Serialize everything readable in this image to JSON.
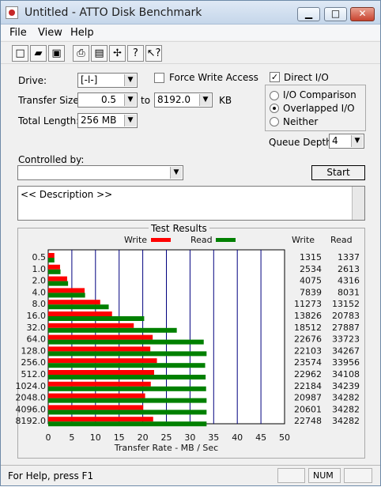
{
  "window": {
    "title": "Untitled - ATTO Disk Benchmark"
  },
  "menubar": {
    "items": [
      "File",
      "View",
      "Help"
    ]
  },
  "toolbar": {
    "icons": [
      "new-file-icon",
      "open-folder-icon",
      "save-icon",
      "print-icon",
      "print-preview-icon",
      "move-icon",
      "help-icon",
      "context-help-icon"
    ]
  },
  "settings": {
    "drive_label": "Drive:",
    "drive_value": "[-l-]",
    "force_write_access": "Force Write Access",
    "direct_io": "Direct I/O",
    "transfer_size_label": "Transfer Size:",
    "transfer_from": "0.5",
    "to_label": "to",
    "transfer_to": "8192.0",
    "unit_label": "KB",
    "total_length_label": "Total Length:",
    "total_length_value": "256 MB",
    "io_comparison": "I/O Comparison",
    "overlapped_io": "Overlapped I/O",
    "neither": "Neither",
    "queue_depth_label": "Queue Depth:",
    "queue_depth_value": "4",
    "controlled_by_label": "Controlled by:",
    "start_button": "Start",
    "description_text": "<< Description >>"
  },
  "results": {
    "title": "Test Results",
    "write_header": "Write",
    "read_header": "Read"
  },
  "chart_data": {
    "type": "bar",
    "xlabel": "Transfer Rate - MB / Sec",
    "xlim": [
      0,
      50
    ],
    "xticks": [
      0,
      5,
      10,
      15,
      20,
      25,
      30,
      35,
      40,
      45,
      50
    ],
    "grid": true,
    "legend": [
      "Write",
      "Read"
    ],
    "categories": [
      "0.5",
      "1.0",
      "2.0",
      "4.0",
      "8.0",
      "16.0",
      "32.0",
      "64.0",
      "128.0",
      "256.0",
      "512.0",
      "1024.0",
      "2048.0",
      "4096.0",
      "8192.0"
    ],
    "series": [
      {
        "name": "Write",
        "color": "#ff0000",
        "values": [
          1.3,
          2.5,
          4.0,
          7.7,
          11.0,
          13.5,
          18.1,
          22.1,
          21.6,
          23.0,
          22.4,
          21.7,
          20.5,
          20.1,
          22.2
        ]
      },
      {
        "name": "Read",
        "color": "#008000",
        "values": [
          1.3,
          2.6,
          4.2,
          7.8,
          12.8,
          20.3,
          27.2,
          32.9,
          33.5,
          33.2,
          33.3,
          33.4,
          33.5,
          33.5,
          33.5
        ]
      }
    ],
    "write_values": [
      "1315",
      "2534",
      "4075",
      "7839",
      "11273",
      "13826",
      "18512",
      "22676",
      "22103",
      "23574",
      "22962",
      "22184",
      "20987",
      "20601",
      "22748"
    ],
    "read_values": [
      "1337",
      "2613",
      "4316",
      "8031",
      "13152",
      "20783",
      "27887",
      "33723",
      "34267",
      "33956",
      "34108",
      "34239",
      "34282",
      "34282",
      "34282"
    ]
  },
  "status": {
    "help_text": "For Help, press F1",
    "num": "NUM"
  },
  "colors": {
    "write": "#ff0000",
    "read": "#008000",
    "grid_blue": "#00007f"
  }
}
